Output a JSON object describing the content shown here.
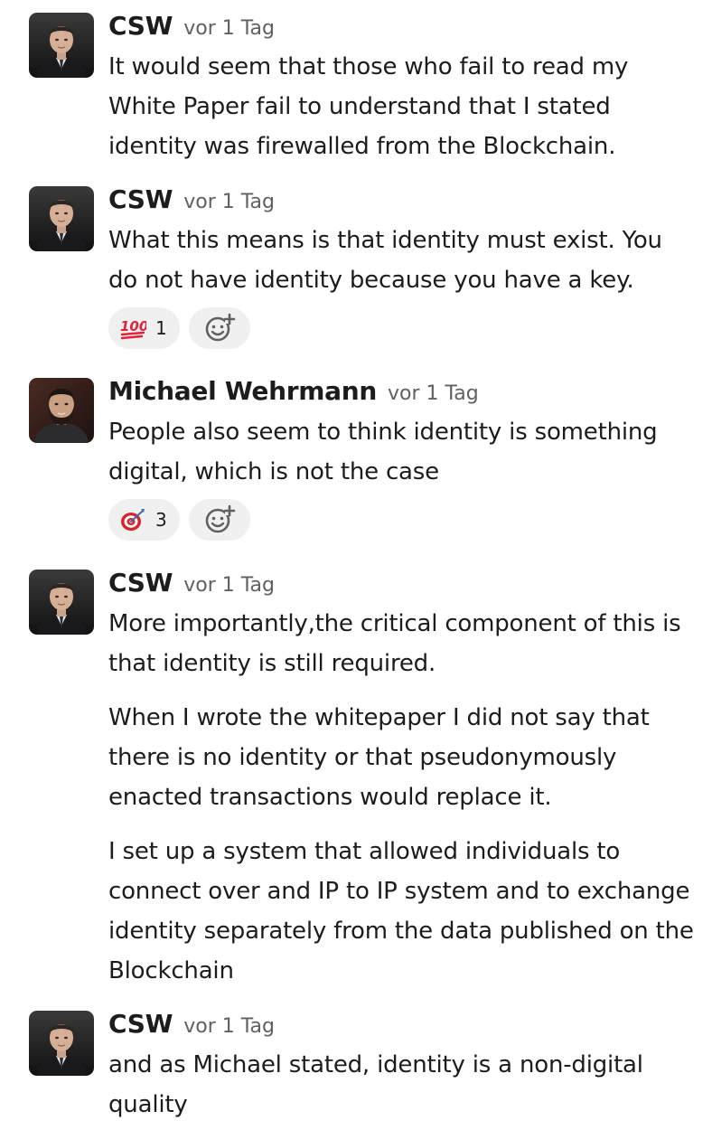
{
  "messages": [
    {
      "author": "CSW",
      "time": "vor 1 Tag",
      "avatar": "csw-avatar",
      "paragraphs": [
        "It would seem that those who fail to read my White Paper fail to understand that I stated identity was firewalled from the Blockchain."
      ]
    },
    {
      "author": "CSW",
      "time": "vor 1 Tag",
      "avatar": "csw-avatar",
      "paragraphs": [
        "What this means is that identity must exist. You do not have identity because you have a key."
      ],
      "reactions": [
        {
          "emoji": "hundred-points-icon",
          "count": "1"
        }
      ]
    },
    {
      "author": "Michael Wehrmann",
      "time": "vor 1 Tag",
      "avatar": "michael-avatar",
      "paragraphs": [
        "People also seem to think identity is something digital, which is not the case"
      ],
      "reactions": [
        {
          "emoji": "direct-hit-icon",
          "count": "3"
        }
      ]
    },
    {
      "author": "CSW",
      "time": "vor 1 Tag",
      "avatar": "csw-avatar",
      "paragraphs": [
        "More importantly,the critical component of this is that identity is still required.",
        "When I wrote the whitepaper I did not say that there is no identity or that pseudonymously enacted transactions would replace it.",
        "I set up a system that allowed individuals to connect over and IP to IP system and to exchange identity separately from the data published on the Blockchain"
      ]
    },
    {
      "author": "CSW",
      "time": "vor 1 Tag",
      "avatar": "csw-avatar",
      "paragraphs": [
        "and as Michael stated, identity is a non-digital quality"
      ]
    }
  ],
  "icons": {
    "add_reaction": "add-reaction-icon"
  },
  "colors": {
    "reaction_bg": "#f0f0f0",
    "timestamp": "#616061",
    "text": "#1d1c1d",
    "hundred_red": "#e0243b",
    "target_red": "#d8232e"
  }
}
